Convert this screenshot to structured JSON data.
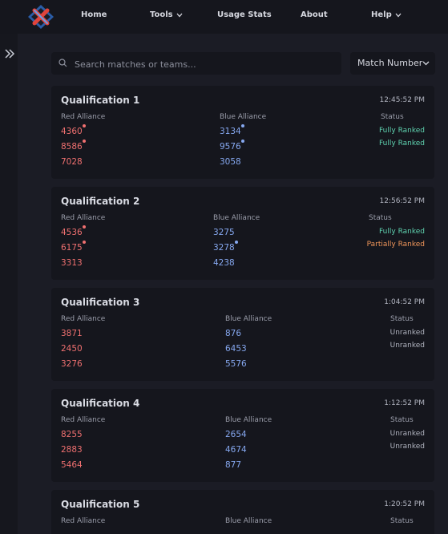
{
  "nav": {
    "home": "Home",
    "tools": "Tools",
    "usage": "Usage Stats",
    "about": "About",
    "help": "Help"
  },
  "search": {
    "placeholder": "Search matches or teams..."
  },
  "sort": {
    "label": "Match Number"
  },
  "labels": {
    "red": "Red Alliance",
    "blue": "Blue Alliance",
    "status": "Status"
  },
  "colors": {
    "red_team": "#f07070",
    "blue_team": "#86a8f0",
    "fully_ranked": "#5fd3b0",
    "partially_ranked": "#f0965a"
  },
  "matches": [
    {
      "title": "Qualification 1",
      "time": "12:45:52 PM",
      "red": [
        "4360",
        "8586",
        "7028"
      ],
      "blue": [
        "3134",
        "9576",
        "3058"
      ],
      "status": [
        "Fully Ranked",
        "Fully Ranked"
      ]
    },
    {
      "title": "Qualification 2",
      "time": "12:56:52 PM",
      "red": [
        "4536",
        "6175",
        "3313"
      ],
      "blue": [
        "3275",
        "3278",
        "4238"
      ],
      "status": [
        "Fully Ranked",
        "Partially Ranked"
      ]
    },
    {
      "title": "Qualification 3",
      "time": "1:04:52 PM",
      "red": [
        "3871",
        "2450",
        "3276"
      ],
      "blue": [
        "876",
        "6453",
        "5576"
      ],
      "status": [
        "Unranked",
        "Unranked"
      ]
    },
    {
      "title": "Qualification 4",
      "time": "1:12:52 PM",
      "red": [
        "8255",
        "2883",
        "5464"
      ],
      "blue": [
        "2654",
        "4674",
        "877"
      ],
      "status": [
        "Unranked",
        "Unranked"
      ]
    },
    {
      "title": "Qualification 5",
      "time": "1:20:52 PM"
    }
  ]
}
